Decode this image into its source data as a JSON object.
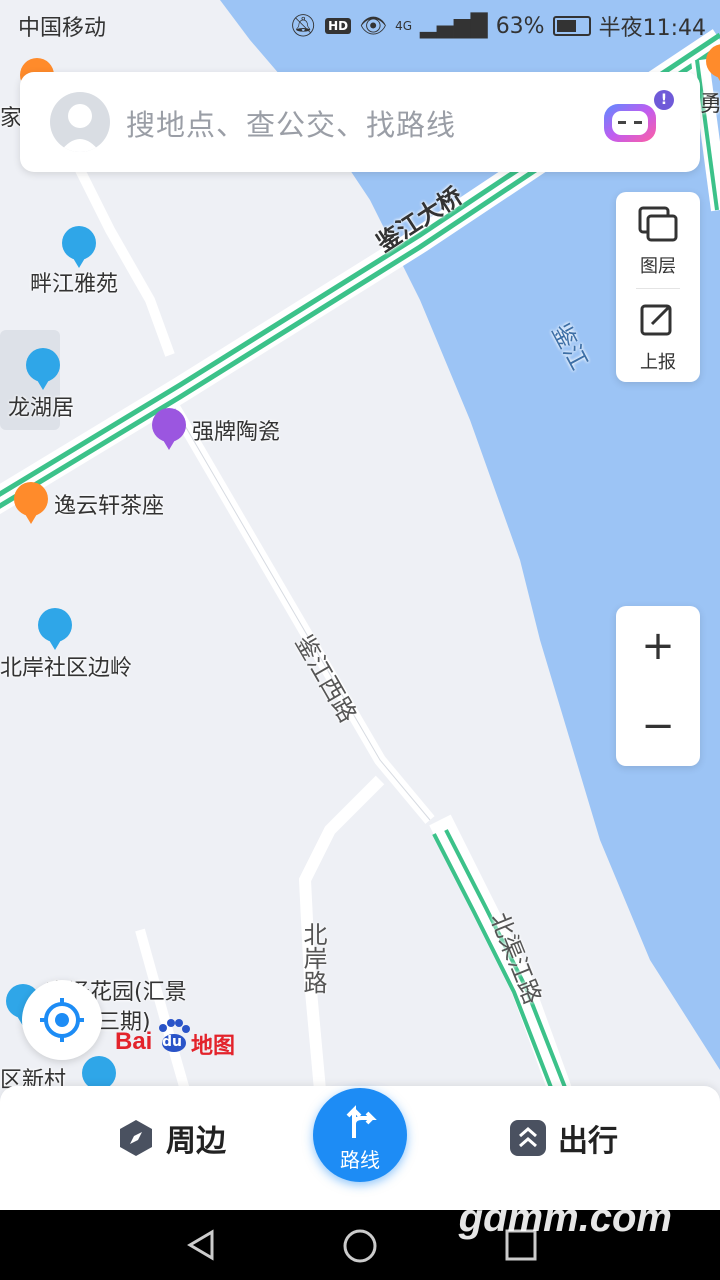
{
  "status_bar": {
    "carrier": "中国移动",
    "hd": "HD",
    "signal": "4G",
    "battery": "63%",
    "time": "半夜11:44"
  },
  "search": {
    "placeholder": "搜地点、查公交、找路线",
    "badge": "!"
  },
  "tools": {
    "layers": "图层",
    "report": "上报"
  },
  "zoom": {
    "in": "+",
    "out": "−"
  },
  "map": {
    "pois": [
      {
        "name": "畔江雅苑",
        "icon": "building-icon"
      },
      {
        "name": "龙湖居",
        "icon": "building-icon"
      },
      {
        "name": "强牌陶瓷",
        "icon": "shopping-bag-icon"
      },
      {
        "name": "逸云轩茶座",
        "icon": "coffee-icon"
      },
      {
        "name": "北岸社区边岭",
        "icon": "building-icon"
      },
      {
        "name": "高泽花园(汇景",
        "icon": "building-icon"
      },
      {
        "name": "三期)",
        "icon": ""
      },
      {
        "name": "区新村",
        "icon": "building-icon"
      },
      {
        "name": "家宴",
        "icon": "restaurant-icon"
      },
      {
        "name": "勇",
        "icon": "restaurant-icon"
      }
    ],
    "roads": {
      "bridge": "鉴江大桥",
      "river": "鉴江",
      "west_road": "鉴江西路",
      "north_shore_road": "北岸路",
      "north_canal_road": "北渠江路"
    }
  },
  "logo": {
    "bai": "Bai",
    "du": "du",
    "map": "地图"
  },
  "bottom": {
    "nearby": "周边",
    "route": "路线",
    "travel": "出行"
  },
  "watermark": "gdmm.com",
  "colors": {
    "water": "#9cc4f5",
    "land": "#eef0f5",
    "road_green": "#3cc28a",
    "accent": "#1d8cf5"
  }
}
